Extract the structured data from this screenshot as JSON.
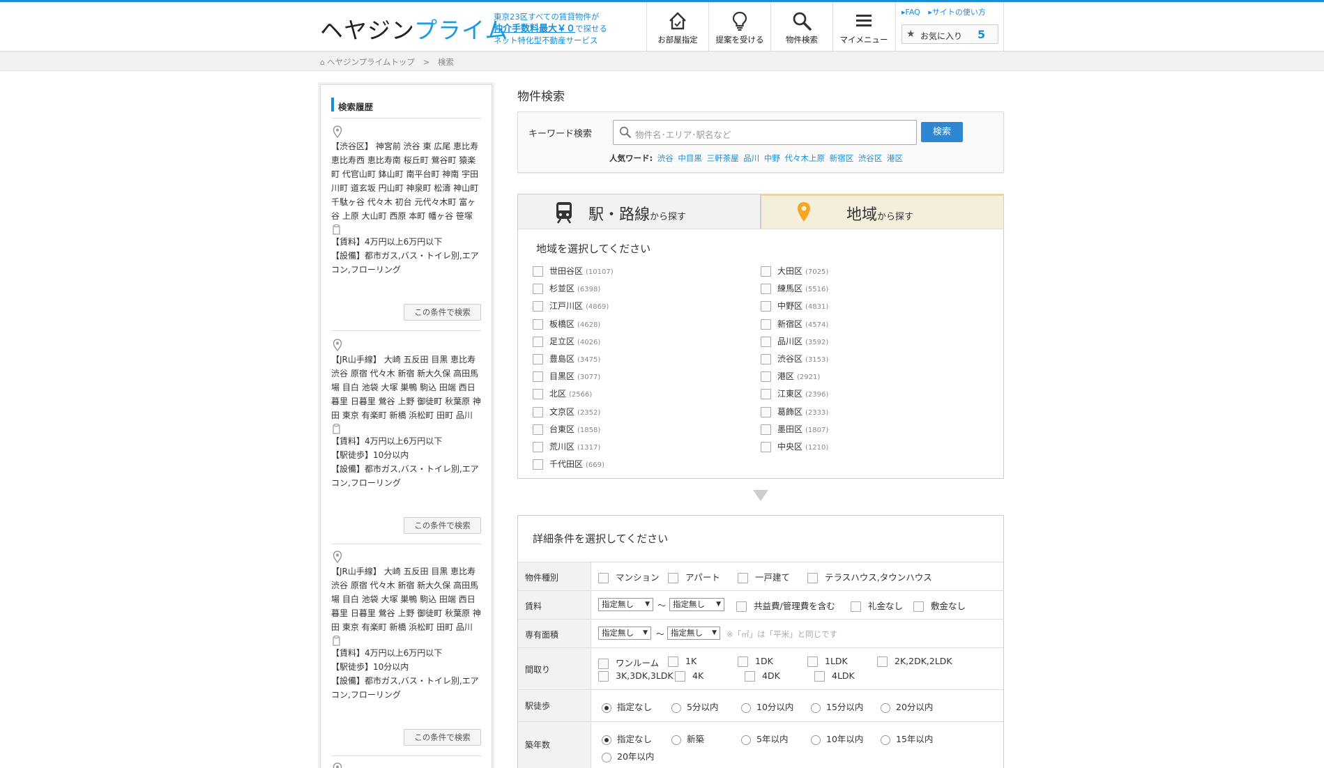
{
  "header": {
    "logo_a": "ヘヤジン",
    "logo_b": "プライム",
    "tagline_1": "東京23区すべての賃貸物件が",
    "tagline_hl": "仲介手数料最大￥０",
    "tagline_2": "で探せる",
    "tagline_3": "ネット特化型不動産サービス",
    "nav": [
      "お部屋指定",
      "提案を受ける",
      "物件検索",
      "マイメニュー"
    ],
    "link_faq": "FAQ",
    "link_howto": "サイトの使い方",
    "fav_label": "お気に入り",
    "fav_count": "5"
  },
  "breadcrumb": {
    "home": "ヘヤジンプライムトップ",
    "sep": ">",
    "current": "検索"
  },
  "sidebar": {
    "title": "検索履歴",
    "button": "この条件で検索",
    "history": [
      {
        "area": "【渋谷区】 神宮前 渋谷 東 広尾 恵比寿 恵比寿西 恵比寿南 桜丘町 鶯谷町 猿楽町 代官山町 鉢山町 南平台町 神南 宇田川町 道玄坂 円山町 神泉町 松濤 神山町 千駄ヶ谷 代々木 初台 元代々木町 富ヶ谷 上原 大山町 西原 本町 幡ヶ谷 笹塚",
        "conds": [
          "【賃料】4万円以上6万円以下",
          "【設備】都市ガス,バス・トイレ別,エアコン,フローリング"
        ]
      },
      {
        "area": "【JR山手線】 大崎 五反田 目黒 恵比寿 渋谷 原宿 代々木 新宿 新大久保 高田馬場 目白 池袋 大塚 巣鴨 駒込 田端 西日暮里 日暮里 鶯谷 上野 御徒町 秋葉原 神田 東京 有楽町 新橋 浜松町 田町 品川",
        "conds": [
          "【賃料】4万円以上6万円以下",
          "【駅徒歩】10分以内",
          "【設備】都市ガス,バス・トイレ別,エアコン,フローリング"
        ]
      },
      {
        "area": "【JR山手線】 大崎 五反田 目黒 恵比寿 渋谷 原宿 代々木 新宿 新大久保 高田馬場 目白 池袋 大塚 巣鴨 駒込 田端 西日暮里 日暮里 鶯谷 上野 御徒町 秋葉原 神田 東京 有楽町 新橋 浜松町 田町 品川",
        "conds": [
          "【賃料】4万円以上6万円以下",
          "【駅徒歩】10分以内",
          "【設備】都市ガス,バス・トイレ別,エアコン,フローリング"
        ]
      }
    ]
  },
  "main": {
    "title": "物件検索",
    "kw_label": "キーワード検索",
    "kw_placeholder": "物件名･エリア･駅名など",
    "kw_button": "検索",
    "popular_label": "人気ワード:",
    "popular": [
      "渋谷",
      "中目黒",
      "三軒茶屋",
      "品川",
      "中野",
      "代々木上原",
      "新宿区",
      "渋谷区",
      "港区"
    ],
    "tab_station_big": "駅・路線",
    "tab_station_small": "から探す",
    "tab_area_big": "地域",
    "tab_area_small": "から探す",
    "area_head": "地域を選択してください",
    "wards_left": [
      {
        "name": "世田谷区",
        "count": "(10107)"
      },
      {
        "name": "杉並区",
        "count": "(6398)"
      },
      {
        "name": "江戸川区",
        "count": "(4869)"
      },
      {
        "name": "板橋区",
        "count": "(4628)"
      },
      {
        "name": "足立区",
        "count": "(4026)"
      },
      {
        "name": "豊島区",
        "count": "(3475)"
      },
      {
        "name": "目黒区",
        "count": "(3077)"
      },
      {
        "name": "北区",
        "count": "(2566)"
      },
      {
        "name": "文京区",
        "count": "(2352)"
      },
      {
        "name": "台東区",
        "count": "(1858)"
      },
      {
        "name": "荒川区",
        "count": "(1317)"
      },
      {
        "name": "千代田区",
        "count": "(669)"
      }
    ],
    "wards_right": [
      {
        "name": "大田区",
        "count": "(7025)"
      },
      {
        "name": "練馬区",
        "count": "(5516)"
      },
      {
        "name": "中野区",
        "count": "(4831)"
      },
      {
        "name": "新宿区",
        "count": "(4574)"
      },
      {
        "name": "品川区",
        "count": "(3592)"
      },
      {
        "name": "渋谷区",
        "count": "(3153)"
      },
      {
        "name": "港区",
        "count": "(2921)"
      },
      {
        "name": "江東区",
        "count": "(2396)"
      },
      {
        "name": "葛飾区",
        "count": "(2333)"
      },
      {
        "name": "墨田区",
        "count": "(1807)"
      },
      {
        "name": "中央区",
        "count": "(1210)"
      }
    ],
    "detail_head": "詳細条件を選択してください",
    "type_label": "物件種別",
    "types": [
      "マンション",
      "アパート",
      "一戸建て",
      "テラスハウス,タウンハウス"
    ],
    "rent_label": "賃料",
    "rent_min": "指定無し",
    "rent_max": "指定無し",
    "tilde": "～",
    "rent_opts": [
      "共益費/管理費を含む",
      "礼金なし",
      "敷金なし"
    ],
    "area_label": "専有面積",
    "area_min": "指定無し",
    "area_max": "指定無し",
    "area_note": "※「㎡」は「平米」と同じです",
    "layout_label": "間取り",
    "layouts_1": [
      "ワンルーム",
      "1K",
      "1DK",
      "1LDK",
      "2K,2DK,2LDK"
    ],
    "layouts_2": [
      "3K,3DK,3LDK",
      "4K",
      "4DK",
      "4LDK"
    ],
    "walk_label": "駅徒歩",
    "walks": [
      "指定なし",
      "5分以内",
      "10分以内",
      "15分以内",
      "20分以内"
    ],
    "age_label": "築年数",
    "ages": [
      "指定なし",
      "新築",
      "5年以内",
      "10年以内",
      "15年以内",
      "20年以内"
    ]
  }
}
